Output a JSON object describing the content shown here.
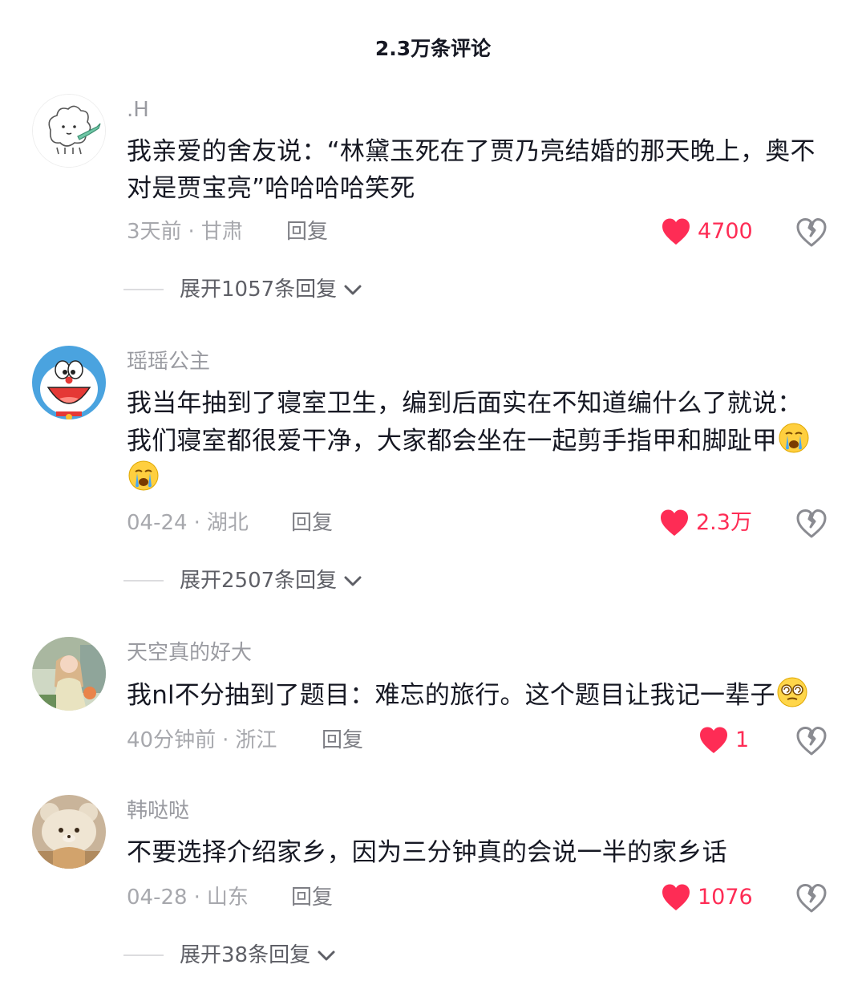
{
  "header": {
    "title": "2.3万条评论"
  },
  "comments": [
    {
      "username": ".H",
      "text": "我亲爱的舍友说：“林黛玉死在了贾乃亮结婚的那天晚上，奥不对是贾宝亮”哈哈哈哈笑死",
      "time": "3天前",
      "location": "甘肃",
      "reply_label": "回复",
      "likes": "4700",
      "expand_label": "展开1057条回复",
      "avatar_icon": "sheep-cartoon-icon"
    },
    {
      "username": "瑶瑶公主",
      "text_line1": "我当年抽到了寝室卫生，编到后面实在不知道编什么了就说：",
      "text_line2": "我们寝室都很爱干净，大家都会坐在一起剪手指甲和脚趾甲",
      "time": "04-24",
      "location": "湖北",
      "reply_label": "回复",
      "likes": "2.3万",
      "expand_label": "展开2507条回复",
      "emoji": "crying-face-icon",
      "avatar_icon": "doraemon-icon"
    },
    {
      "username": "天空真的好大",
      "text": "我nl不分抽到了题目：难忘的旅行。这个题目让我记一辈子",
      "time": "40分钟前",
      "location": "浙江",
      "reply_label": "回复",
      "likes": "1",
      "emoji": "dizzy-face-icon",
      "avatar_icon": "girl-photo-icon"
    },
    {
      "username": "韩哒哒",
      "text": "不要选择介绍家乡，因为三分钟真的会说一半的家乡话",
      "time": "04-28",
      "location": "山东",
      "reply_label": "回复",
      "likes": "1076",
      "expand_label": "展开38条回复",
      "avatar_icon": "bear-hat-cat-icon"
    }
  ],
  "colors": {
    "like": "#fe2c55",
    "meta": "#a7a8ad",
    "text": "#161823"
  },
  "meta_separator": "·"
}
